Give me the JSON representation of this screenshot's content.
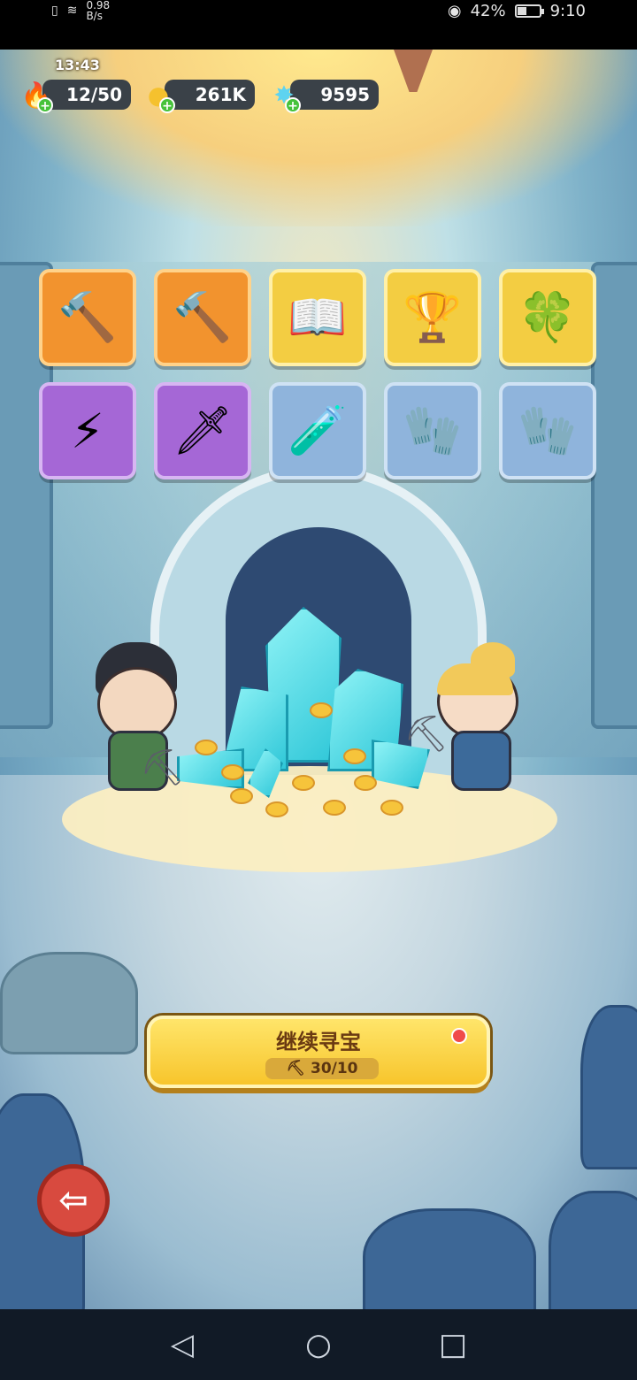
{
  "status_bar": {
    "speed_value": "0.98",
    "speed_unit": "B/s",
    "battery": "42%",
    "time": "9:10"
  },
  "hud": {
    "timer": "13:43",
    "energy": "12/50",
    "coins": "261K",
    "gems": "9595",
    "energy_icon": "flame-icon",
    "coin_icon": "coin-icon",
    "gem_icon": "crystal-star-icon"
  },
  "items": [
    {
      "name": "hammer",
      "rarity": "orange",
      "glyph": "🔨"
    },
    {
      "name": "hammer",
      "rarity": "orange",
      "glyph": "🔨"
    },
    {
      "name": "spell-book",
      "rarity": "gold",
      "glyph": "📖"
    },
    {
      "name": "golden-goblet",
      "rarity": "gold",
      "glyph": "🏆"
    },
    {
      "name": "clover-ring",
      "rarity": "gold",
      "glyph": "🍀"
    },
    {
      "name": "lightning-scroll",
      "rarity": "purple",
      "glyph": "⚡"
    },
    {
      "name": "frost-sword",
      "rarity": "purple",
      "glyph": "🗡"
    },
    {
      "name": "red-potion",
      "rarity": "blue",
      "glyph": "🧪"
    },
    {
      "name": "leather-glove",
      "rarity": "blue",
      "glyph": "🧤"
    },
    {
      "name": "leather-glove",
      "rarity": "blue",
      "glyph": "🧤"
    }
  ],
  "continue_button": {
    "label": "继续寻宝",
    "pickaxe_count": "30/10"
  },
  "nav": {
    "back_glyph": "◁",
    "home_glyph": "○",
    "recents_glyph": "□"
  },
  "colors": {
    "orange": "#f2932e",
    "gold": "#f3cd42",
    "purple": "#a567d6",
    "blue": "#8fb4dc",
    "button": "#f7c52c"
  }
}
